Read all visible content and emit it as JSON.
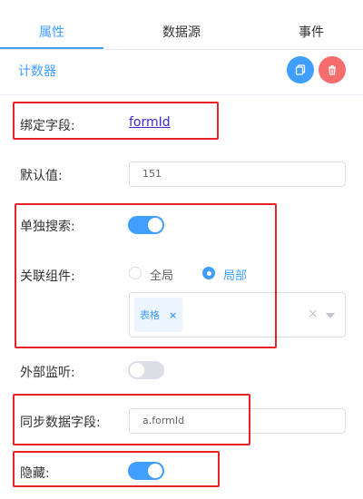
{
  "tabs": [
    {
      "label": "属性",
      "active": true
    },
    {
      "label": "数据源",
      "active": false
    },
    {
      "label": "事件",
      "active": false
    }
  ],
  "section": {
    "title": "计数器",
    "copy_icon": "copy-icon",
    "delete_icon": "trash-icon"
  },
  "fields": {
    "bind_field": {
      "label": "绑定字段:",
      "value": "formId"
    },
    "default_value": {
      "label": "默认值:",
      "value": "151"
    },
    "search_alone": {
      "label": "单独搜索:",
      "enabled": true
    },
    "linked_component": {
      "label": "关联组件:",
      "options": [
        "全局",
        "局部"
      ],
      "selected": "局部",
      "tag": "表格",
      "tag_close": "×",
      "clear_glyph": "×"
    },
    "external_listen": {
      "label": "外部监听:",
      "enabled": false
    },
    "sync_data_field": {
      "label": "同步数据字段:",
      "value": "a.formId"
    },
    "hidden": {
      "label": "隐藏:",
      "enabled": true
    }
  },
  "colors": {
    "accent": "#409eff",
    "danger": "#f56c6c",
    "annotation": "#e8232a",
    "link": "#3b2bd6"
  }
}
